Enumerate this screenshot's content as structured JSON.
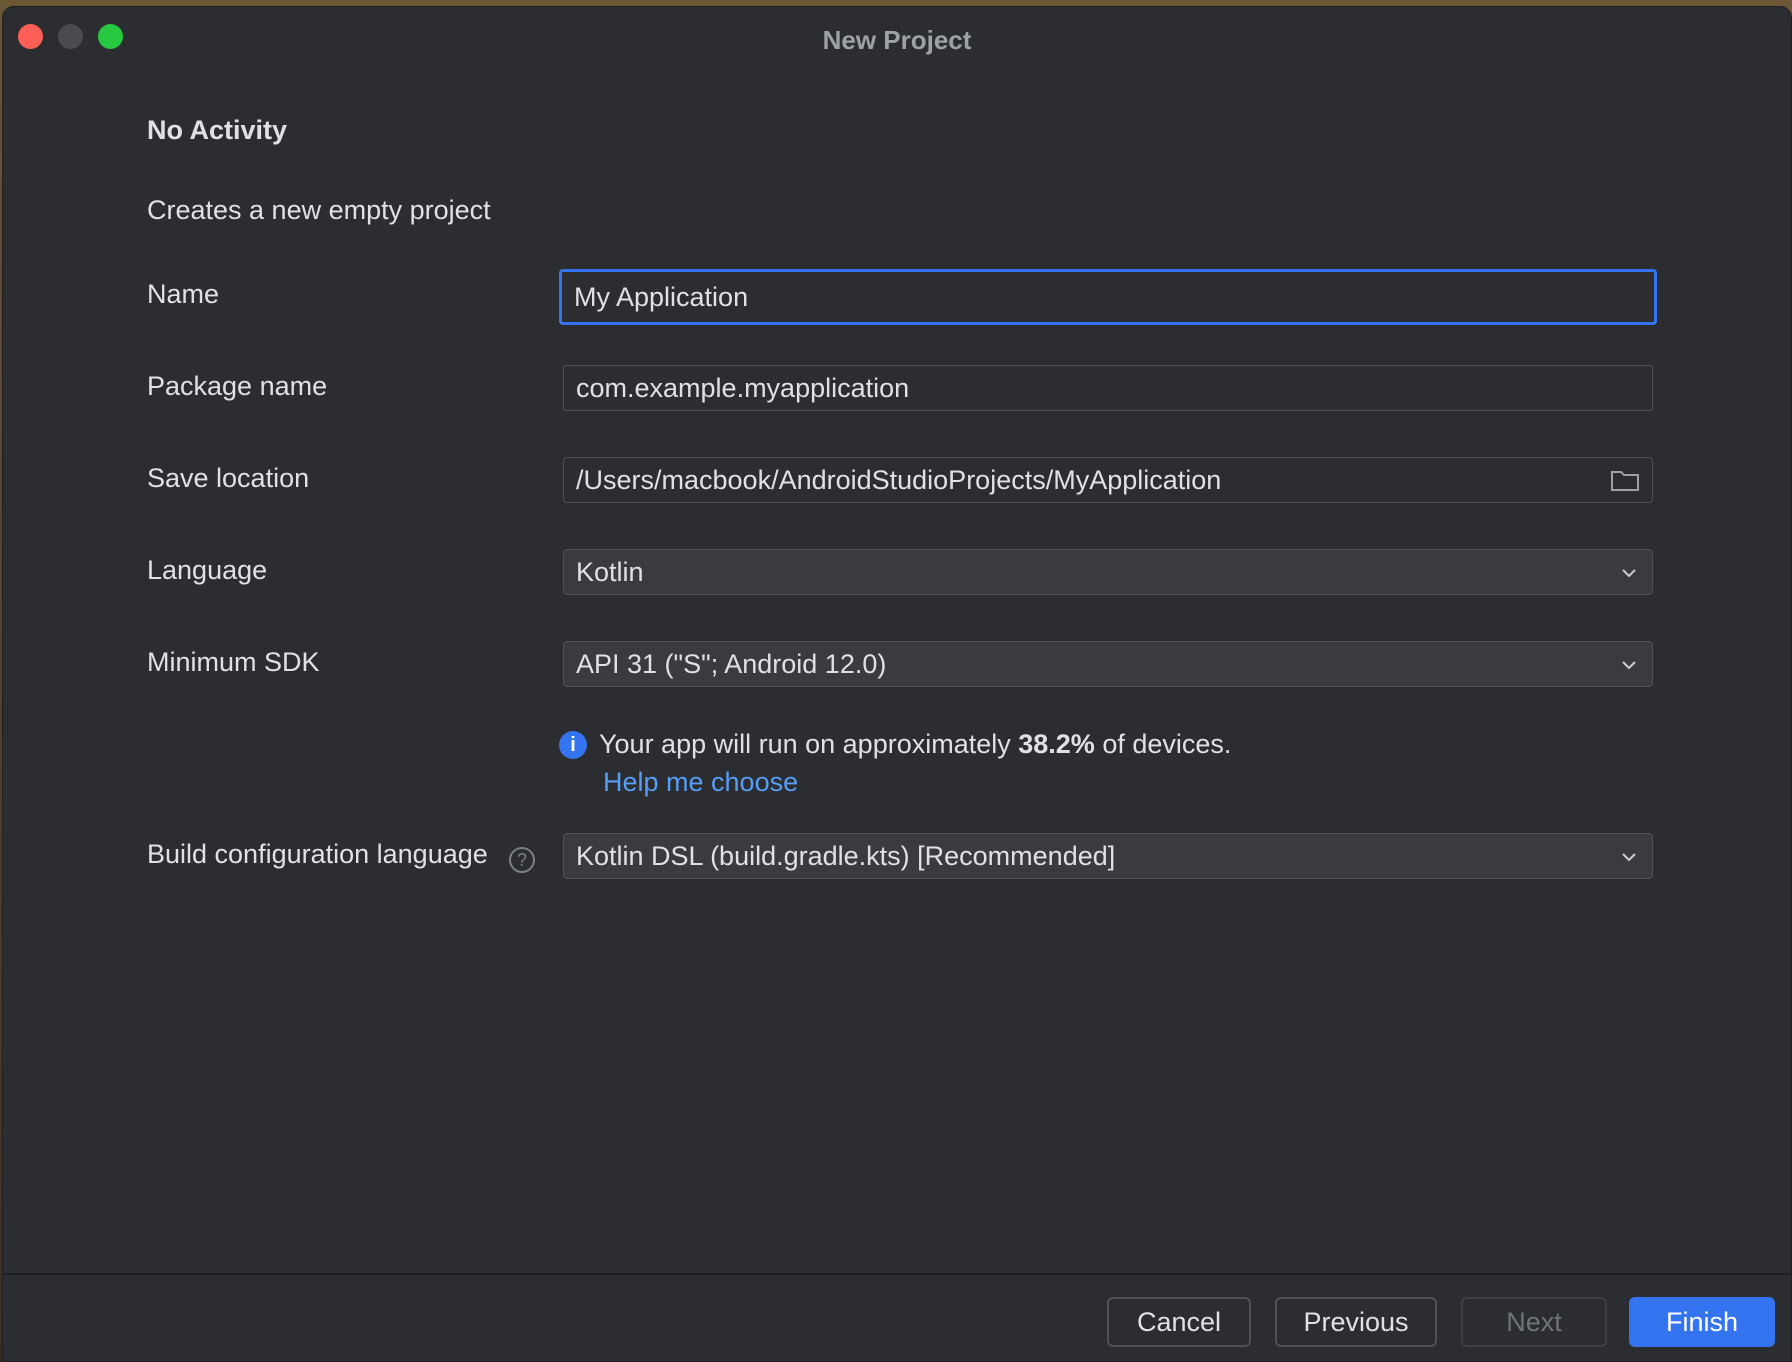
{
  "window": {
    "title": "New Project"
  },
  "template": {
    "heading": "No Activity",
    "description": "Creates a new empty project"
  },
  "form": {
    "name": {
      "label": "Name",
      "value": "My Application"
    },
    "package": {
      "label": "Package name",
      "value": "com.example.myapplication"
    },
    "save_location": {
      "label": "Save location",
      "value": "/Users/macbook/AndroidStudioProjects/MyApplication"
    },
    "language": {
      "label": "Language",
      "value": "Kotlin"
    },
    "min_sdk": {
      "label": "Minimum SDK",
      "value": "API 31 (\"S\"; Android 12.0)"
    },
    "sdk_info": {
      "prefix": "Your app will run on approximately ",
      "percent": "38.2%",
      "suffix": " of devices.",
      "help_link": "Help me choose"
    },
    "build_config": {
      "label": "Build configuration language",
      "value": "Kotlin DSL (build.gradle.kts) [Recommended]"
    }
  },
  "buttons": {
    "cancel": "Cancel",
    "previous": "Previous",
    "next": "Next",
    "finish": "Finish"
  },
  "colors": {
    "accent": "#3574f0",
    "link": "#589df6",
    "background": "#2b2d30"
  }
}
